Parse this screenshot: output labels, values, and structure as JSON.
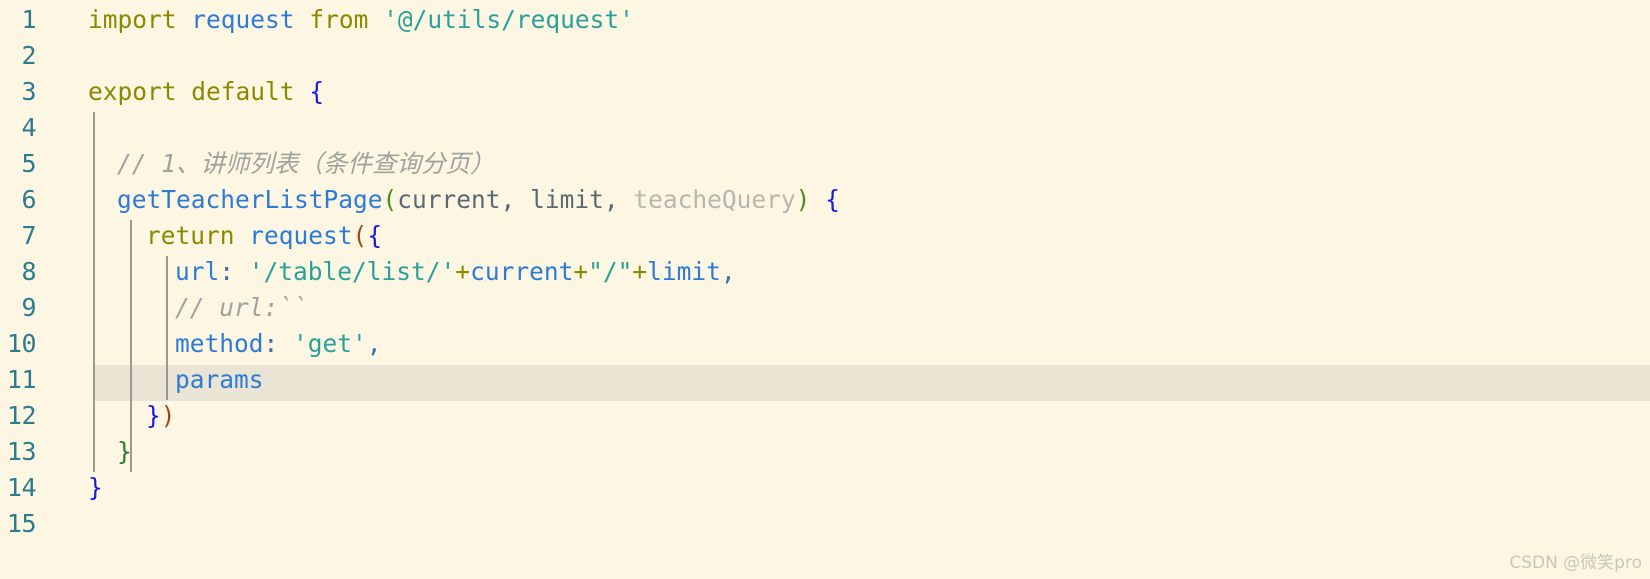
{
  "editor": {
    "background_color": "#FDF6E3",
    "current_line_highlight_color": "#E9E4D4",
    "gutter_color": "#2C7C8E",
    "total_lines": 15,
    "current_line": 11
  },
  "line_numbers": [
    "1",
    "2",
    "3",
    "4",
    "5",
    "6",
    "7",
    "8",
    "9",
    "10",
    "11",
    "12",
    "13",
    "14",
    "15"
  ],
  "code_lines": [
    {
      "number": "1",
      "text": "import request from '@/utils/request'"
    },
    {
      "number": "2",
      "text": ""
    },
    {
      "number": "3",
      "text": "export default {"
    },
    {
      "number": "4",
      "text": ""
    },
    {
      "number": "5",
      "text": "  // 1、讲师列表（条件查询分页）"
    },
    {
      "number": "6",
      "text": "  getTeacherListPage(current, limit, teacheQuery) {"
    },
    {
      "number": "7",
      "text": "    return request({"
    },
    {
      "number": "8",
      "text": "      url: '/table/list/'+current+\"/\"+limit,"
    },
    {
      "number": "9",
      "text": "      // url:``"
    },
    {
      "number": "10",
      "text": "      method: 'get',"
    },
    {
      "number": "11",
      "text": "      params"
    },
    {
      "number": "12",
      "text": "    })"
    },
    {
      "number": "13",
      "text": "  }"
    },
    {
      "number": "14",
      "text": "}"
    },
    {
      "number": "15",
      "text": ""
    }
  ],
  "tokens": {
    "line1": {
      "import": "import",
      "space1": " ",
      "request": "request",
      "space2": " ",
      "from": "from",
      "space3": " ",
      "module_path": "'@/utils/request'"
    },
    "line3": {
      "export": "export",
      "space1": " ",
      "default": "default",
      "space2": " ",
      "brace": "{"
    },
    "line5": {
      "comment": "// 1、讲师列表（条件查询分页）"
    },
    "line6": {
      "method_name": "getTeacherListPage",
      "paren_open": "(",
      "param1": "current",
      "comma1": ", ",
      "param2": "limit",
      "comma2": ", ",
      "param3": "teacheQuery",
      "paren_close": ")",
      "space": " ",
      "brace": "{"
    },
    "line7": {
      "return": "return",
      "space": " ",
      "request": "request",
      "paren": "(",
      "brace": "{"
    },
    "line8": {
      "key": "url",
      "colon": ": ",
      "str1": "'/table/list/'",
      "plus1": "+",
      "var1": "current",
      "plus2": "+",
      "str2": "\"/\"",
      "plus3": "+",
      "var2": "limit",
      "comma": ","
    },
    "line9": {
      "comment": "// url:``"
    },
    "line10": {
      "key": "method",
      "colon": ": ",
      "value": "'get'",
      "comma": ","
    },
    "line11": {
      "key": "params"
    },
    "line12": {
      "brace": "}",
      "paren": ")"
    },
    "line13": {
      "brace": "}"
    },
    "line14": {
      "brace": "}"
    }
  },
  "watermark": {
    "text": "CSDN @微笑pro"
  }
}
